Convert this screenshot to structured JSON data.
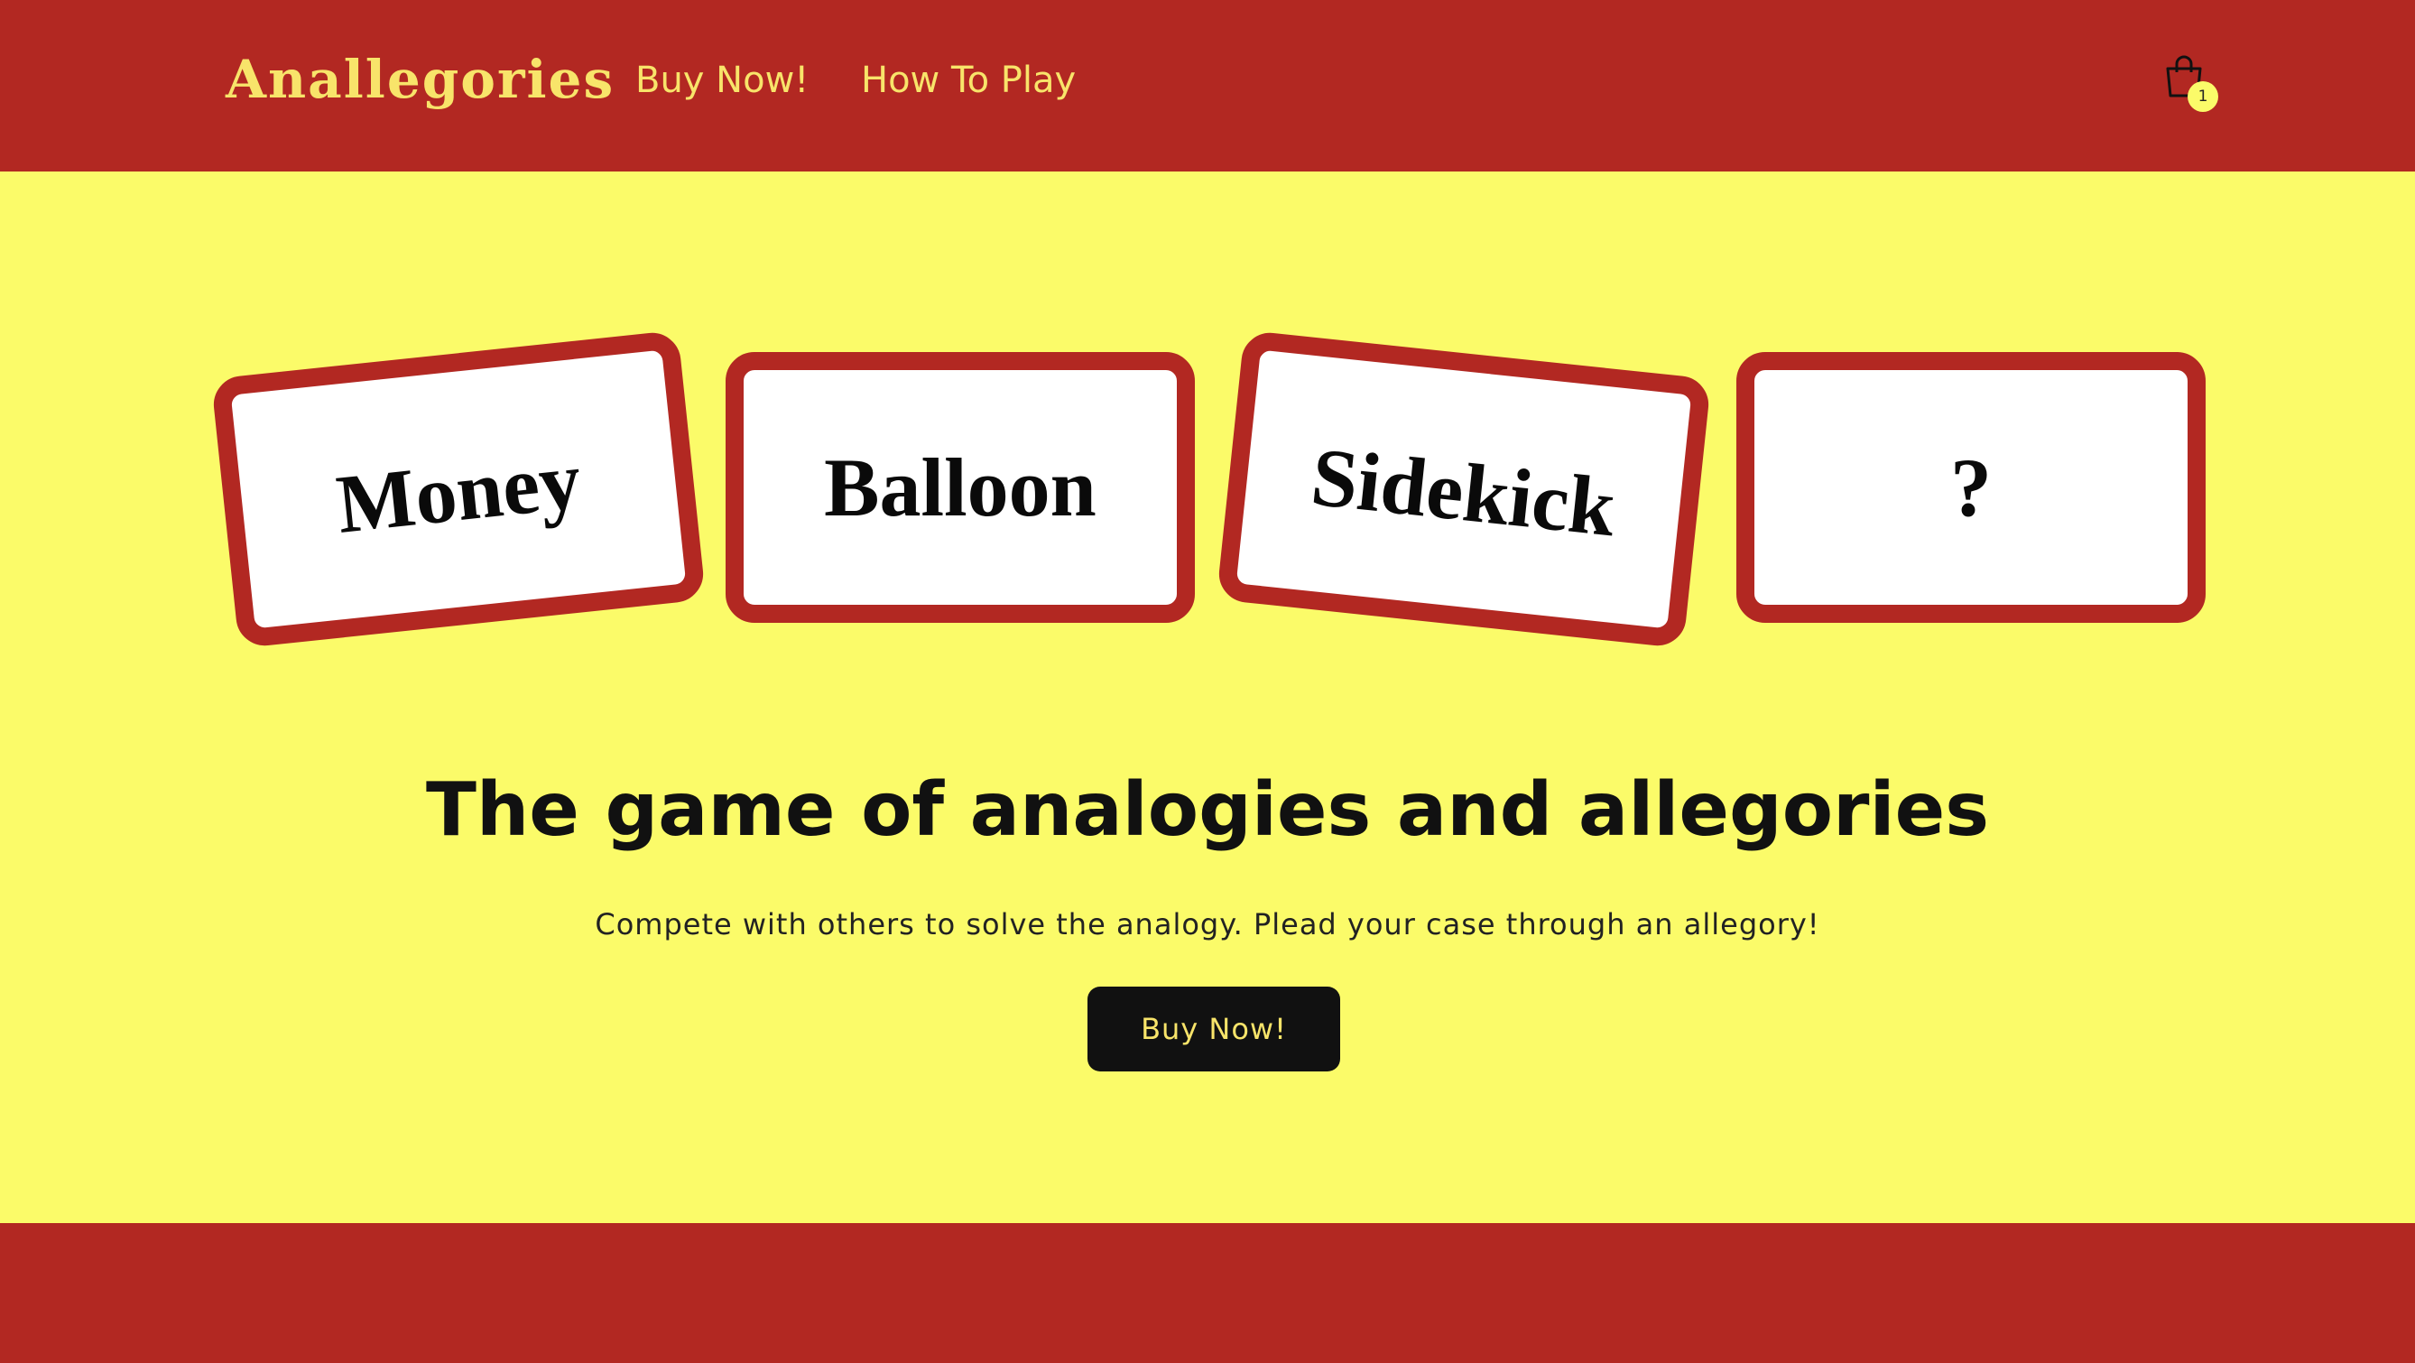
{
  "header": {
    "brand": "Anallegories",
    "nav": [
      {
        "label": "Buy Now!"
      },
      {
        "label": "How To Play"
      }
    ],
    "cart": {
      "icon": "shopping-bag-icon",
      "count": "1"
    }
  },
  "cards": [
    {
      "word": "Money"
    },
    {
      "word": "Balloon"
    },
    {
      "word": "Sidekick"
    },
    {
      "word": "?"
    }
  ],
  "hero": {
    "headline": "The game of analogies and allegories",
    "subline": "Compete with others to solve the analogy. Plead your case through an allegory!",
    "cta": "Buy Now!"
  },
  "colors": {
    "background": "#fbfb69",
    "brand_red": "#b22822",
    "accent_yellow": "#f8e46a",
    "button_dark": "#111111"
  }
}
